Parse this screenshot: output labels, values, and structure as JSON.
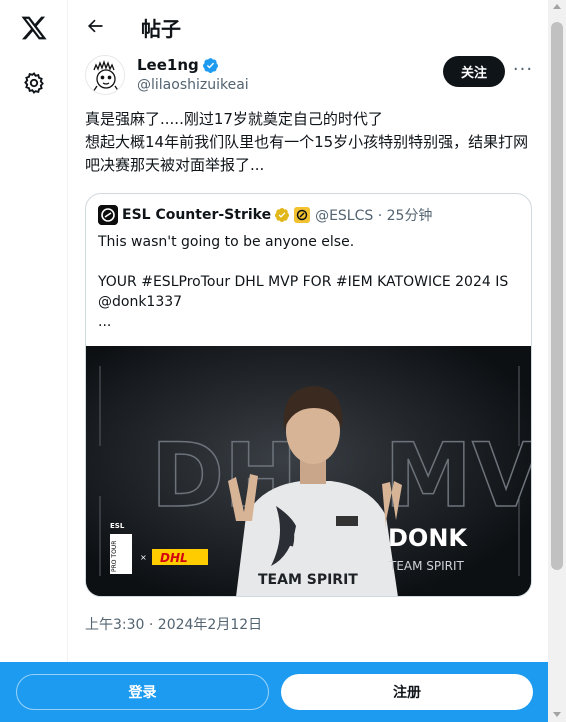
{
  "nav": {
    "logo_icon": "x-logo-icon",
    "settings_icon": "gear-icon"
  },
  "header": {
    "back_icon": "back-arrow-icon",
    "title": "帖子"
  },
  "tweet": {
    "author_name": "Lee1ng",
    "author_handle": "@lilaoshizuikeai",
    "follow_label": "关注",
    "more_label": "···",
    "text": "真是强麻了.....刚过17岁就奠定自己的时代了\n想起大概14年前我们队里也有一个15岁小孩特别特别强，结果打网吧决赛那天被对面举报了...",
    "timestamp": "上午3:30 · 2024年2月12日"
  },
  "quote": {
    "author_name": "ESL Counter-Strike",
    "handle_time": "@ESLCS · 25分钟",
    "text": "This wasn't going to be anyone else.\n\nYOUR #ESLProTour DHL MVP FOR #IEM KATOWICE 2024 IS @donk1337\n...",
    "image": {
      "bg_text": "DHL MVP",
      "player_name": "DONK",
      "player_team": "TEAM SPIRIT",
      "jersey_text": "TEAM SPIRIT",
      "brand_esl": "ESL",
      "brand_protour": "PRO TOUR",
      "brand_x": "×",
      "brand_dhl": "DHL"
    }
  },
  "bottom_bar": {
    "login_label": "登录",
    "signup_label": "注册"
  },
  "colors": {
    "accent": "#1d9bf0",
    "text": "#0f1419",
    "muted": "#536471",
    "gold_badge": "#e2b719",
    "dhl_yellow": "#ffcc00",
    "dhl_red": "#d40511"
  }
}
